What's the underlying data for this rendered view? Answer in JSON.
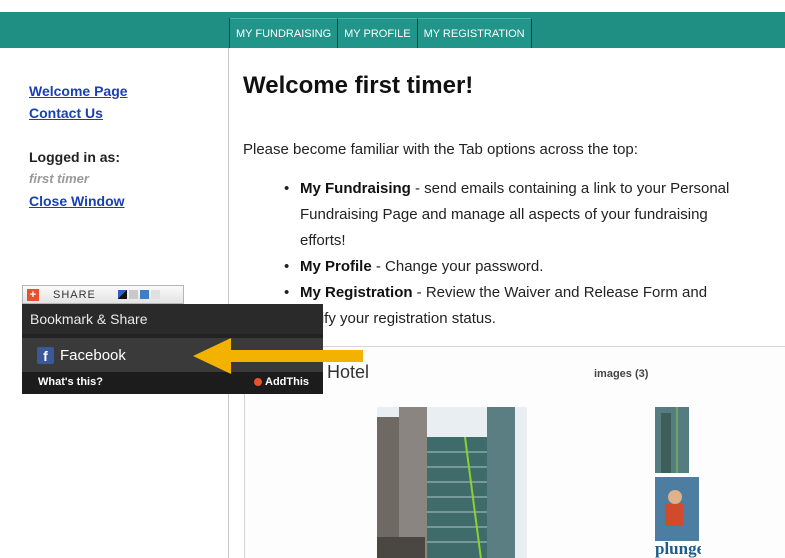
{
  "tabs": [
    {
      "label": "MY FUNDRAISING"
    },
    {
      "label": "MY PROFILE"
    },
    {
      "label": "MY REGISTRATION"
    }
  ],
  "sidebar": {
    "links": [
      "Welcome Page",
      "Contact Us"
    ],
    "logged_in_label": "Logged in as:",
    "user_name": "first timer",
    "close_link": "Close Window"
  },
  "share": {
    "button_label": "SHARE",
    "popup_title": "Bookmark & Share",
    "facebook_label": "Facebook",
    "whats_this": "What's this?",
    "addthis": "AddThis"
  },
  "main": {
    "title": "Welcome first timer!",
    "intro": "Please become familiar with the Tab options across the top:",
    "bullets": [
      {
        "term": "My Fundraising",
        "line1": " - send emails containing a link to your Personal",
        "line2": "Fundraising Page and manage all aspects of your fundraising",
        "line3": "efforts!"
      },
      {
        "term": "My Profile",
        "line1": " - Change your password."
      },
      {
        "term": "My Registration",
        "line1": " - Review the Waiver and Release Form and",
        "line2": "verify your registration status."
      }
    ],
    "gallery_title": "Hotel",
    "images_count": "images (3)",
    "photo_text": "plunge!"
  },
  "colors": {
    "teal": "#1f8f84",
    "link": "#1a3fb5",
    "arrow": "#f3b200",
    "popup": "#222222"
  }
}
